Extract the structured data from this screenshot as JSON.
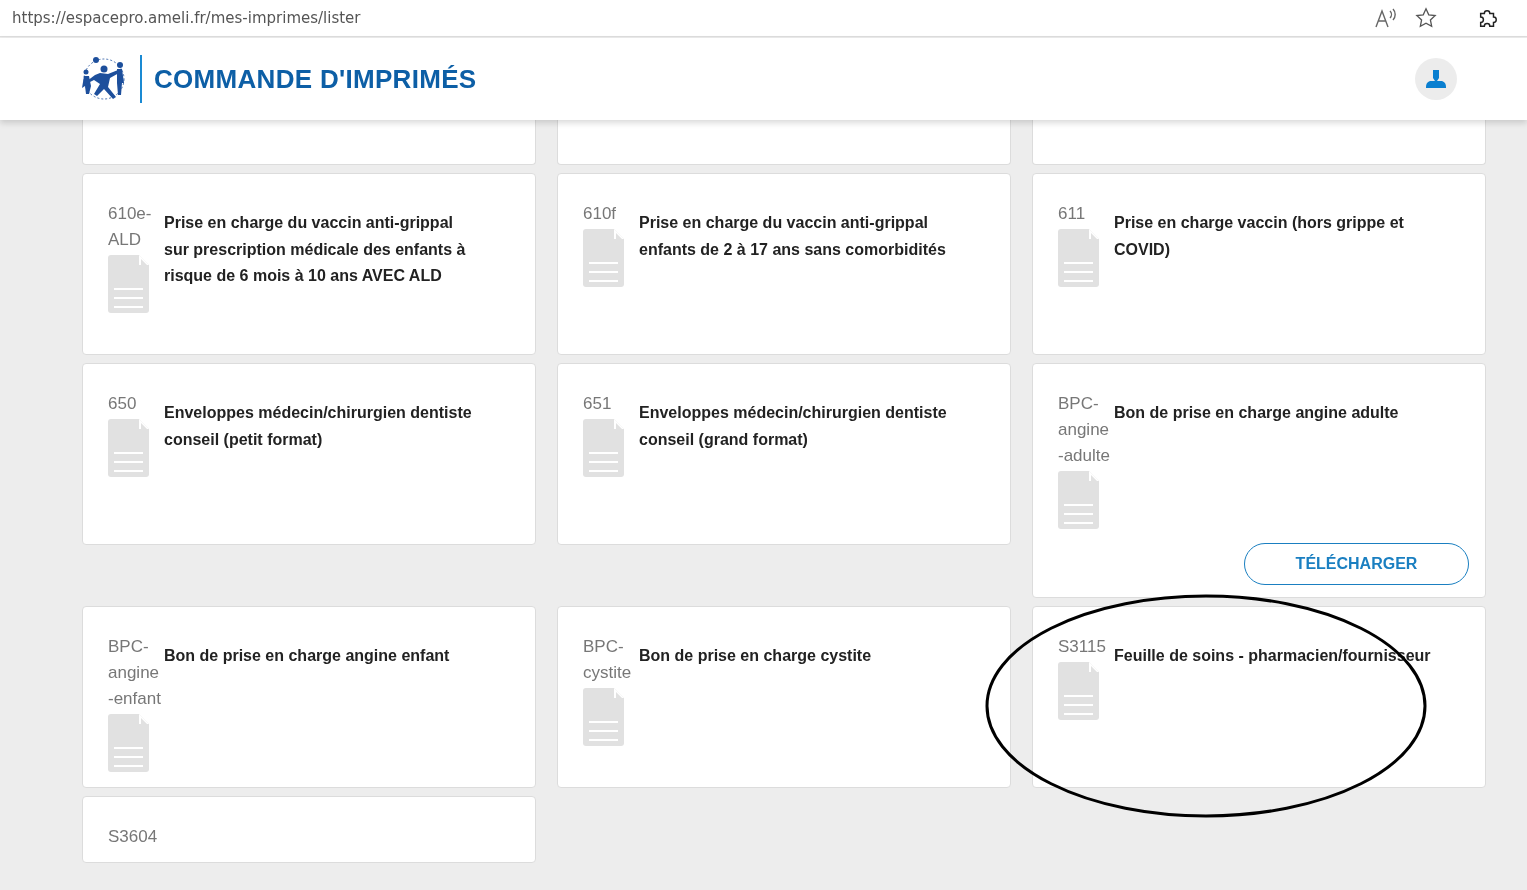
{
  "browser": {
    "url": "https://espacepro.ameli.fr/mes-imprimes/lister"
  },
  "header": {
    "title": "COMMANDE D'IMPRIMÉS"
  },
  "cards": [
    {
      "kind": "cut"
    },
    {
      "kind": "cut"
    },
    {
      "kind": "cut"
    },
    {
      "kind": "form",
      "code": "610e-ALD",
      "title": "Prise en charge du vaccin anti-grippal sur prescription médicale des enfants à risque de 6 mois à 10 ans AVEC ALD",
      "circled": false
    },
    {
      "kind": "form",
      "code": "610f",
      "title": "Prise en charge du vaccin anti-grippal enfants de 2 à 17 ans sans comorbidités",
      "circled": false
    },
    {
      "kind": "form",
      "code": "611",
      "title": "Prise en charge vaccin (hors grippe et COVID)",
      "circled": false
    },
    {
      "kind": "form",
      "code": "650",
      "title": "Enveloppes médecin/chirurgien dentiste conseil (petit format)",
      "circled": false
    },
    {
      "kind": "form",
      "code": "651",
      "title": "Enveloppes médecin/chirurgien dentiste conseil (grand format)",
      "circled": false
    },
    {
      "kind": "form",
      "code": "BPC-angine-adulte",
      "title": "Bon de prise en charge angine adulte",
      "button": "TÉLÉCHARGER",
      "circled": false
    },
    {
      "kind": "form",
      "code": "BPC-angine-enfant",
      "title": "Bon de prise en charge angine enfant",
      "circled": false
    },
    {
      "kind": "form",
      "code": "BPC-cystite",
      "title": "Bon de prise en charge cystite",
      "circled": false
    },
    {
      "kind": "form",
      "code": "S3115",
      "title": "Feuille de soins - pharmacien/fournisseur",
      "circled": true
    },
    {
      "kind": "partial",
      "code": "S3604"
    }
  ]
}
